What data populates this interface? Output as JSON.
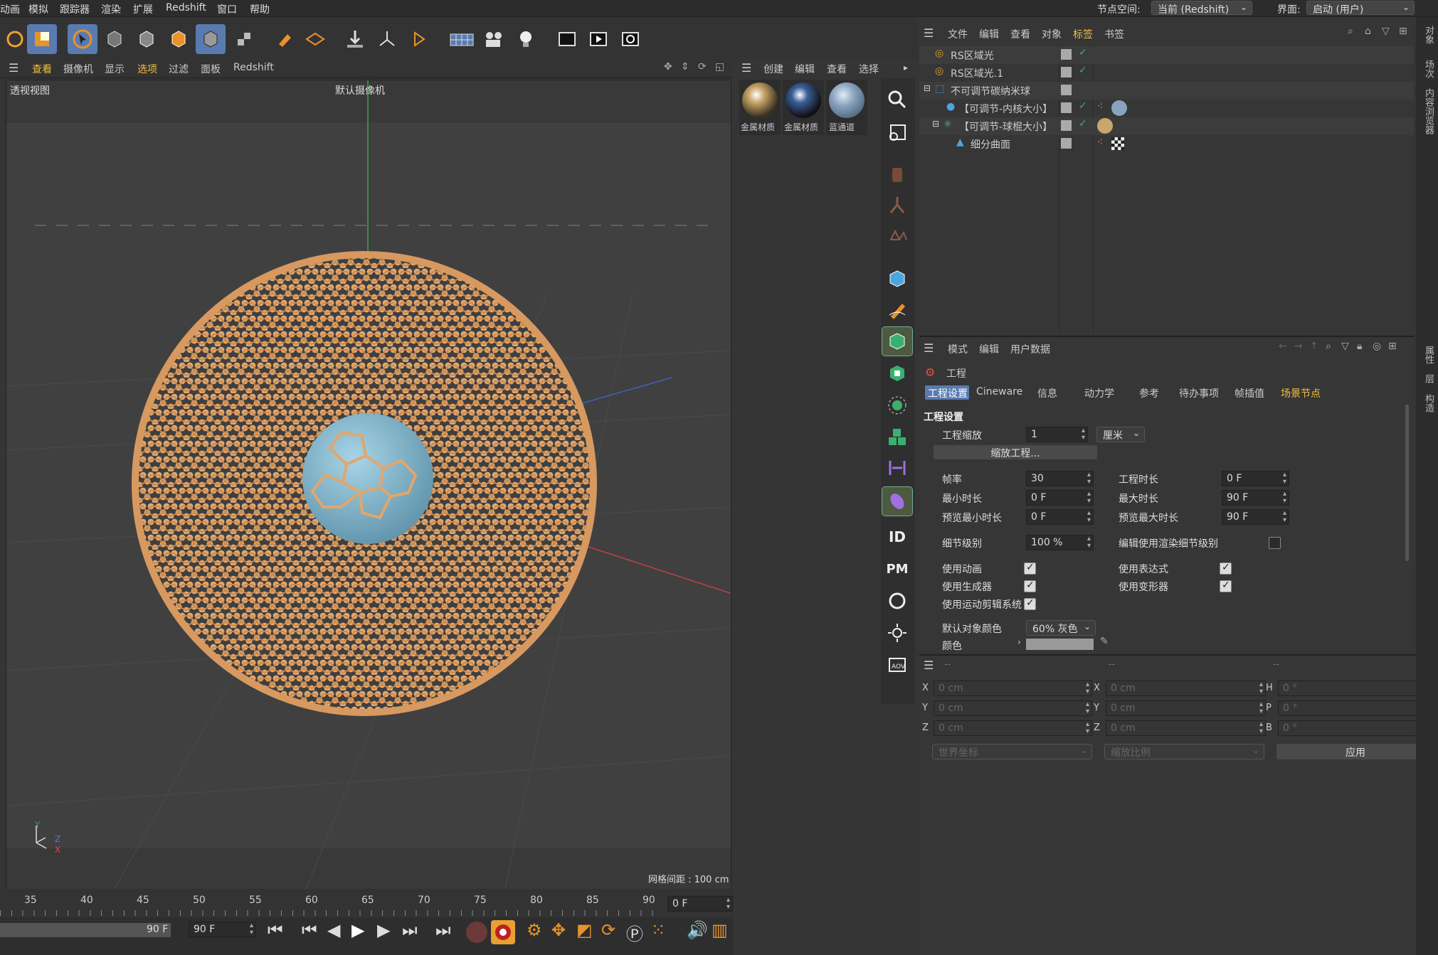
{
  "menubar": {
    "items": [
      "动画",
      "模拟",
      "跟踪器",
      "渲染",
      "扩展",
      "Redshift",
      "窗口",
      "帮助"
    ],
    "node_space_label": "节点空间:",
    "node_space_value": "当前 (Redshift)",
    "layout_label": "界面:",
    "layout_value": "启动 (用户)"
  },
  "viewport": {
    "menu": [
      "查看",
      "摄像机",
      "显示",
      "选项",
      "过滤",
      "面板",
      "Redshift"
    ],
    "view_name": "透视视图",
    "camera_name": "默认摄像机",
    "grid_spacing": "网格间距 : 100 cm",
    "axis_y": "Y",
    "axis_z": "Z",
    "axis_x": "X",
    "colors": {
      "sphere": "#e2a66c",
      "core": "#7ab3cb",
      "y_axis": "#3fa050",
      "x_axis": "#c04040",
      "z_axis": "#4060c0"
    }
  },
  "timeline": {
    "ticks": [
      "35",
      "40",
      "45",
      "50",
      "55",
      "60",
      "65",
      "70",
      "75",
      "80",
      "85",
      "90"
    ],
    "current_frame": "0 F",
    "end_frame_left": "90 F",
    "end_frame_field": "90 F"
  },
  "material_manager": {
    "menu": [
      "创建",
      "编辑",
      "查看",
      "选择"
    ],
    "materials": [
      {
        "name": "金属材质",
        "color": "#c9a66a"
      },
      {
        "name": "金属材质",
        "color": "#3a5f9a"
      },
      {
        "name": "蓝通道",
        "color": "#8aa4c0"
      }
    ]
  },
  "object_manager": {
    "menu": [
      "文件",
      "编辑",
      "查看",
      "对象",
      "标签",
      "书签"
    ],
    "objects": [
      {
        "name": "RS区域光",
        "indent": 0
      },
      {
        "name": "RS区域光.1",
        "indent": 0
      },
      {
        "name": "不可调节碳纳米球",
        "indent": 0
      },
      {
        "name": "【可调节-内核大小】",
        "indent": 1
      },
      {
        "name": "【可调节-球棍大小】",
        "indent": 1
      },
      {
        "name": "细分曲面",
        "indent": 2
      }
    ]
  },
  "attributes": {
    "menu": [
      "模式",
      "编辑",
      "用户数据"
    ],
    "object_title": "工程",
    "tabs": [
      "工程设置",
      "Cineware",
      "信息",
      "动力学",
      "参考",
      "待办事项",
      "帧插值",
      "场景节点"
    ],
    "section": "工程设置",
    "project_scale_label": "工程缩放",
    "project_scale_value": "1",
    "project_scale_unit": "厘米",
    "scale_project_button": "缩放工程...",
    "fps_label": "帧率",
    "fps_value": "30",
    "project_length_label": "工程时长",
    "project_length_value": "0 F",
    "min_length_label": "最小时长",
    "min_length_value": "0 F",
    "max_length_label": "最大时长",
    "max_length_value": "90 F",
    "preview_min_label": "预览最小时长",
    "preview_min_value": "0 F",
    "preview_max_label": "预览最大时长",
    "preview_max_value": "90 F",
    "lod_label": "细节级别",
    "lod_value": "100 %",
    "render_lod_label": "编辑使用渲染细节级别",
    "use_animation_label": "使用动画",
    "use_expression_label": "使用表达式",
    "use_generators_label": "使用生成器",
    "use_deformers_label": "使用变形器",
    "use_motion_label": "使用运动剪辑系统",
    "default_color_label": "默认对象颜色",
    "default_color_value": "60% 灰色",
    "color_label": "颜色",
    "default_color_swatch": "#999999"
  },
  "coordinates": {
    "headers": [
      "--",
      "--",
      "--"
    ],
    "pos": [
      {
        "axis": "X",
        "value": "0 cm"
      },
      {
        "axis": "Y",
        "value": "0 cm"
      },
      {
        "axis": "Z",
        "value": "0 cm"
      }
    ],
    "size": [
      {
        "axis": "X",
        "value": "0 cm"
      },
      {
        "axis": "Y",
        "value": "0 cm"
      },
      {
        "axis": "Z",
        "value": "0 cm"
      }
    ],
    "rot": [
      {
        "axis": "H",
        "value": "0 °"
      },
      {
        "axis": "P",
        "value": "0 °"
      },
      {
        "axis": "B",
        "value": "0 °"
      }
    ],
    "space": "世界坐标",
    "scale_mode": "缩放比例",
    "apply": "应用"
  },
  "right_strip": {
    "tabs_top": [
      "对象",
      "场次",
      "内容浏览器"
    ],
    "tabs_mid": [
      "属性",
      "层",
      "构造"
    ]
  }
}
